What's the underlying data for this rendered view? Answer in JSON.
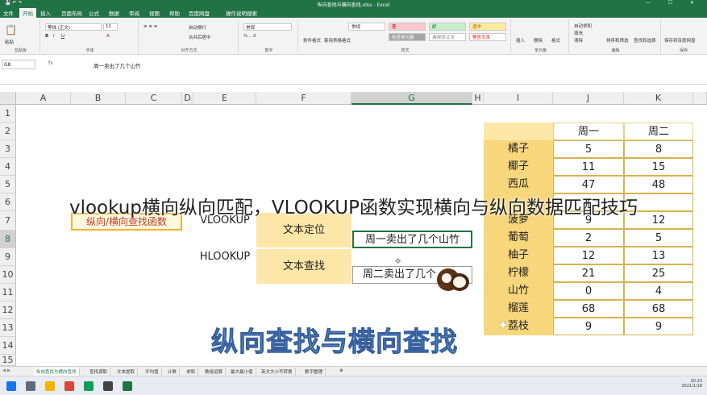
{
  "window": {
    "title": "纵向查找与横向查找.xlsx  -  Excel"
  },
  "menu": [
    "文件",
    "开始",
    "插入",
    "页面布局",
    "公式",
    "数据",
    "审阅",
    "视图",
    "帮助",
    "百度网盘",
    "操作说明搜索"
  ],
  "ribbon": {
    "font_name": "等线 (正文)",
    "font_size": "11",
    "number_format": "常规",
    "styles": [
      "常规",
      "差",
      "好",
      "适中",
      "检查单元格",
      "解释性文本",
      "警告文本"
    ],
    "groups": [
      "剪贴板",
      "字体",
      "对齐方式",
      "数字",
      "样式",
      "单元格",
      "编辑",
      "保存"
    ],
    "buttons": [
      "粘贴",
      "自动换行",
      "合并后居中",
      "条件格式",
      "套用表格格式",
      "插入",
      "删除",
      "格式",
      "自动求和",
      "填充",
      "清除",
      "排序和筛选",
      "查找和选择",
      "保存到百度网盘"
    ]
  },
  "formula_bar": {
    "name_box": "G8",
    "fx": "fx",
    "formula": "周一卖出了几个山竹"
  },
  "columns": [
    "A",
    "B",
    "C",
    "D",
    "E",
    "F",
    "G",
    "H",
    "I",
    "J",
    "K"
  ],
  "rows": [
    "1",
    "2",
    "3",
    "4",
    "5",
    "6",
    "7",
    "8",
    "9",
    "10",
    "11",
    "12",
    "13",
    "14",
    "15"
  ],
  "left_panel": {
    "label_box": "纵向/横向查找函数",
    "vlookup": "VLOOKUP",
    "hlookup": "HLOOKUP",
    "locate_label": "文本定位",
    "search_label": "文本查找",
    "g8": "周一卖出了几个山竹",
    "g10": "周二卖出了几个"
  },
  "table": {
    "headers": [
      "周一",
      "周二"
    ],
    "rows": [
      {
        "fruit": "橘子",
        "mon": "5",
        "tue": "8"
      },
      {
        "fruit": "椰子",
        "mon": "11",
        "tue": "15"
      },
      {
        "fruit": "西瓜",
        "mon": "47",
        "tue": "48"
      },
      {
        "fruit": "",
        "mon": "",
        "tue": ""
      },
      {
        "fruit": "菠萝",
        "mon": "9",
        "tue": "12"
      },
      {
        "fruit": "葡萄",
        "mon": "2",
        "tue": "5"
      },
      {
        "fruit": "柚子",
        "mon": "12",
        "tue": "13"
      },
      {
        "fruit": "柠檬",
        "mon": "21",
        "tue": "25"
      },
      {
        "fruit": "山竹",
        "mon": "0",
        "tue": "4"
      },
      {
        "fruit": "榴莲",
        "mon": "68",
        "tue": "68"
      },
      {
        "fruit": "荔枝",
        "mon": "9",
        "tue": "9"
      }
    ]
  },
  "overlay": {
    "title": "vlookup横向纵向匹配，VLOOKUP函数实现横向与纵向数据匹配技巧",
    "banner": "纵向查找与横向查找"
  },
  "sheet_tabs": [
    "纵向查找与横向查找",
    "查找调取",
    "文本提取",
    "平均值",
    "计数",
    "求和",
    "数组运算",
    "最大最小值",
    "英文大小写转换",
    "数字整理"
  ],
  "taskbar": {
    "time": "20:23",
    "date": "2021/1/18"
  },
  "colors": {
    "excel_green": "#217346",
    "header_yellow": "#fce7a8",
    "fruit_yellow": "#f8d67b"
  }
}
